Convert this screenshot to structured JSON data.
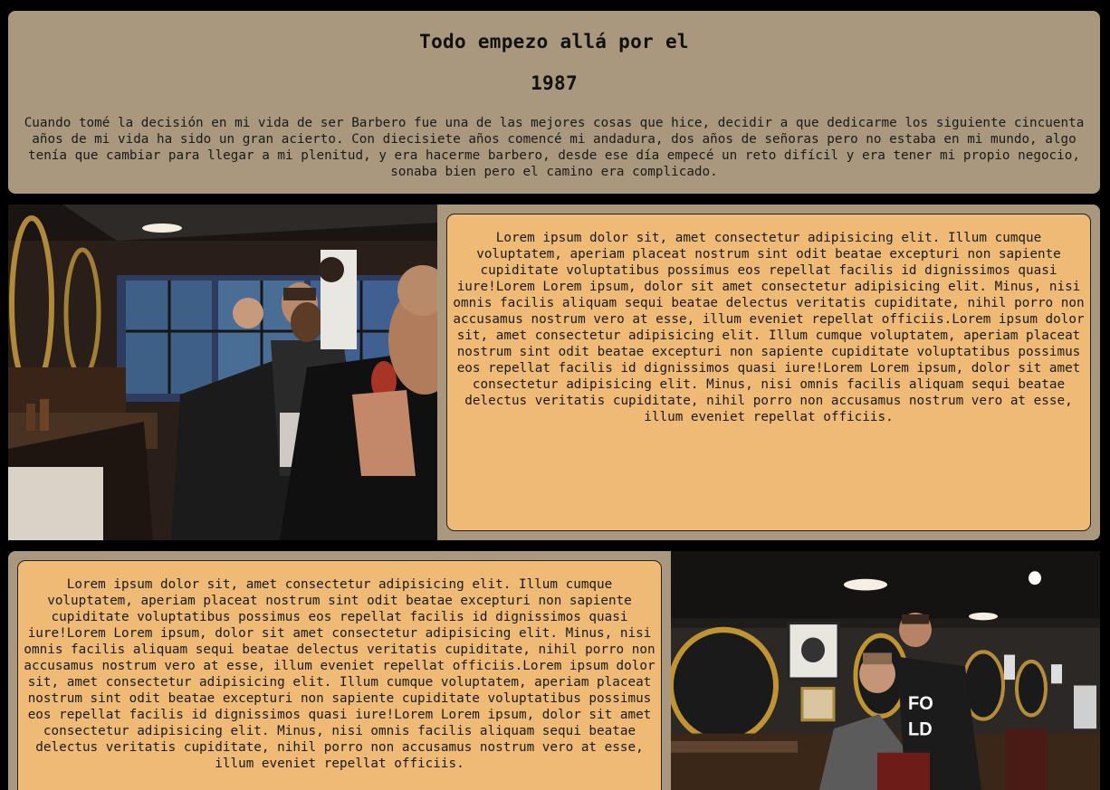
{
  "hero": {
    "title_line1": "Todo empezo allá por el",
    "title_line2": "1987",
    "paragraph": "Cuando tomé la decisión en mi vida de ser Barbero fue una de las mejores cosas que hice, decidir a que dedicarme los siguiente cincuenta años de mi vida ha sido un gran acierto. Con diecisiete años comencé mi andadura, dos años de señoras pero no estaba en mi mundo, algo tenía que cambiar para llegar a mi plenitud, y era hacerme barbero, desde ese día empecé un reto difícil y era tener mi propio negocio, sonaba bien pero el camino era complicado."
  },
  "section1": {
    "image_icon": "barbershop-customers-photo",
    "text": "Lorem ipsum dolor sit, amet consectetur adipisicing elit. Illum cumque voluptatem, aperiam placeat nostrum sint odit beatae excepturi non sapiente cupiditate voluptatibus possimus eos repellat facilis id dignissimos quasi iure!Lorem Lorem ipsum, dolor sit amet consectetur adipisicing elit. Minus, nisi omnis facilis aliquam sequi beatae delectus veritatis cupiditate, nihil porro non accusamus nostrum vero at esse, illum eveniet repellat officiis.Lorem ipsum dolor sit, amet consectetur adipisicing elit. Illum cumque voluptatem, aperiam placeat nostrum sint odit beatae excepturi non sapiente cupiditate voluptatibus possimus eos repellat facilis id dignissimos quasi iure!Lorem Lorem ipsum, dolor sit amet consectetur adipisicing elit. Minus, nisi omnis facilis aliquam sequi beatae delectus veritatis cupiditate, nihil porro non accusamus nostrum vero at esse, illum eveniet repellat officiis."
  },
  "section2": {
    "image_icon": "barber-cutting-hair-photo",
    "text": "Lorem ipsum dolor sit, amet consectetur adipisicing elit. Illum cumque voluptatem, aperiam placeat nostrum sint odit beatae excepturi non sapiente cupiditate voluptatibus possimus eos repellat facilis id dignissimos quasi iure!Lorem Lorem ipsum, dolor sit amet consectetur adipisicing elit. Minus, nisi omnis facilis aliquam sequi beatae delectus veritatis cupiditate, nihil porro non accusamus nostrum vero at esse, illum eveniet repellat officiis.Lorem ipsum dolor sit, amet consectetur adipisicing elit. Illum cumque voluptatem, aperiam placeat nostrum sint odit beatae excepturi non sapiente cupiditate voluptatibus possimus eos repellat facilis id dignissimos quasi iure!Lorem Lorem ipsum, dolor sit amet consectetur adipisicing elit. Minus, nisi omnis facilis aliquam sequi beatae delectus veritatis cupiditate, nihil porro non accusamus nostrum vero at esse, illum eveniet repellat officiis."
  },
  "colors": {
    "page_background": "#000000",
    "panel_background": "#a9987e",
    "text_box_background": "#eeba76"
  }
}
